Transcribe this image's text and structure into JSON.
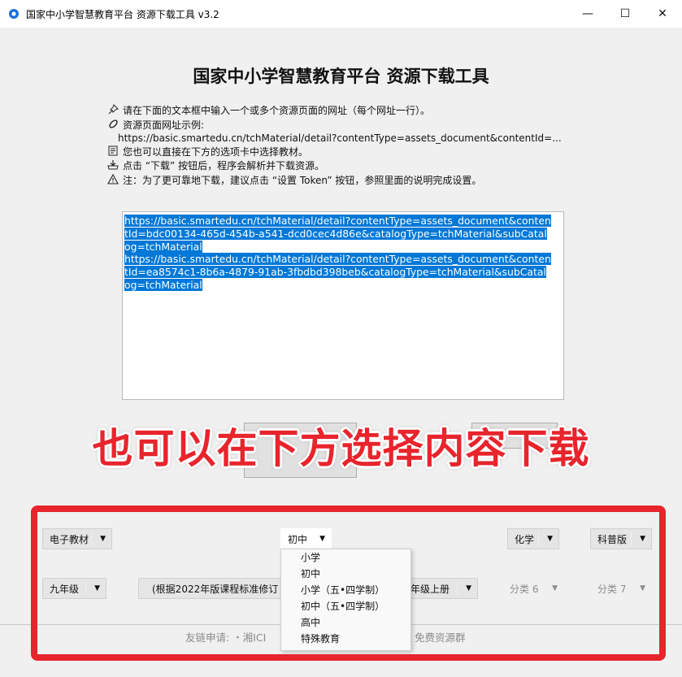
{
  "window": {
    "title": "国家中小学智慧教育平台 资源下载工具 v3.2",
    "minimize": "—",
    "maximize": "☐",
    "close": "✕"
  },
  "header": {
    "title": "国家中小学智慧教育平台 资源下载工具"
  },
  "instructions": {
    "line1": "请在下面的文本框中输入一个或多个资源页面的网址（每个网址一行）。",
    "line2": "资源页面网址示例:",
    "line3": "https://basic.smartedu.cn/tchMaterial/detail?contentType=assets_document&contentId=...",
    "line4": "您也可以直接在下方的选项卡中选择教材。",
    "line5": "点击 “下载” 按钮后，程序会解析并下载资源。",
    "line6": "注：为了更可靠地下载，建议点击 “设置 Token” 按钮，参照里面的说明完成设置。"
  },
  "textbox": {
    "lines": [
      "https://basic.smartedu.cn/tchMaterial/detail?contentType=assets_document&conten",
      "tId=bdc00134-465d-454b-a541-dcd0cec4d86e&catalogType=tchMaterial&subCatal",
      "og=tchMaterial",
      "https://basic.smartedu.cn/tchMaterial/detail?contentType=assets_document&conten",
      "tId=ea8574c1-8b6a-4879-91ab-3fbdbd398beb&catalogType=tchMaterial&subCatal",
      "og=tchMaterial"
    ]
  },
  "overlay": {
    "caption": "也可以在下方选择内容下载"
  },
  "selectors": {
    "row1": {
      "type": "电子教材",
      "level": "初中",
      "subject": "化学",
      "edition": "科普版"
    },
    "row2": {
      "grade": "九年级",
      "book": "(根据2022年版课程标准修订",
      "volume": "年级上册",
      "cat6": "分类 6",
      "cat7": "分类 7"
    }
  },
  "level_dropdown": {
    "options": [
      "小学",
      "初中",
      "小学（五•四学制）",
      "初中（五•四学制）",
      "高中",
      "特殊教育"
    ]
  },
  "footer": {
    "links_label": "友链申请: ・湘ICI",
    "group": "免费资源群"
  },
  "colors": {
    "accent_red": "#e8242c",
    "selection_blue": "#0078d7"
  }
}
